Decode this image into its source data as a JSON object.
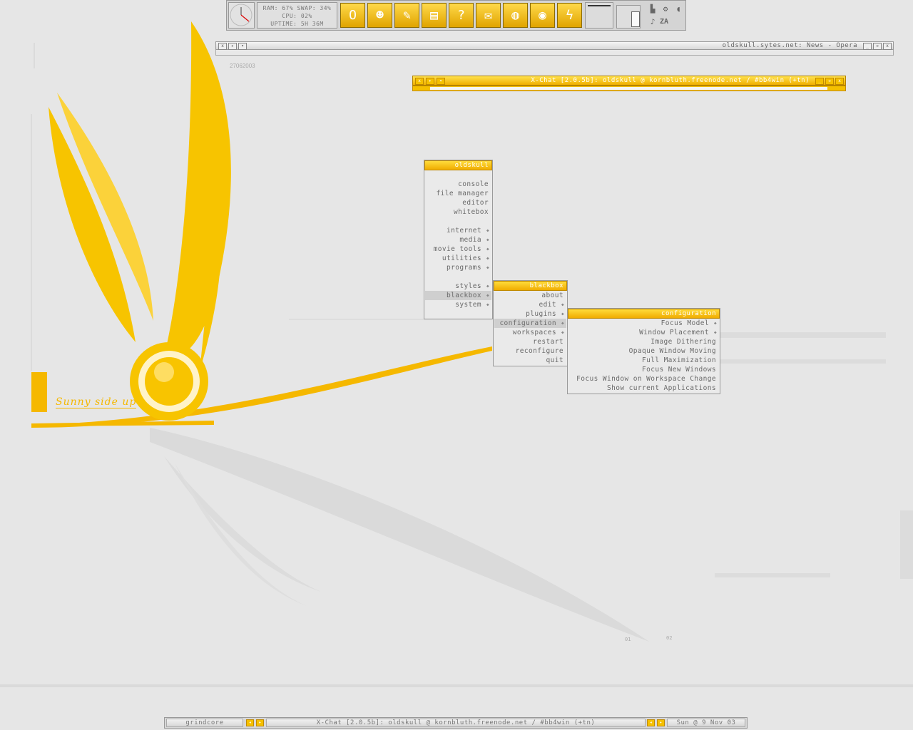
{
  "wallpaper": {
    "caption": "Sunny side up",
    "date_stamp": "27062003",
    "marker_1": "01",
    "marker_2": "02",
    "accent": "#f5b800"
  },
  "dock": {
    "stats": {
      "line1": "RAM: 67%  SWAP: 34%",
      "line2": "CPU: 02%",
      "line3": "UPTIME: 5H 36M"
    },
    "launchers": [
      {
        "icon": "opera-icon",
        "glyph": "O"
      },
      {
        "icon": "xchat-icon",
        "glyph": "☻"
      },
      {
        "icon": "chat-bubble-icon",
        "glyph": "✎"
      },
      {
        "icon": "drive-icon",
        "glyph": "▤"
      },
      {
        "icon": "help-icon",
        "glyph": "?"
      },
      {
        "icon": "mail-icon",
        "glyph": "✉"
      },
      {
        "icon": "jar-icon",
        "glyph": "◍"
      },
      {
        "icon": "globe-icon",
        "glyph": "◉"
      },
      {
        "icon": "lightning-icon",
        "glyph": "ϟ"
      }
    ],
    "tray_kb": "ZA"
  },
  "windows": {
    "opera_title": "oldskull.sytes.net: News - Opera",
    "xchat_title": "X-Chat [2.0.5b]: oldskull @ kornbluth.freenode.net / #bb4win (+tn)"
  },
  "menus": {
    "root": {
      "title": "oldskull",
      "items": [
        "console",
        "file manager",
        "editor",
        "whitebox"
      ],
      "submenus": [
        "internet",
        "media",
        "movie tools",
        "utilities",
        "programs"
      ],
      "bottom": [
        "styles",
        "blackbox",
        "system"
      ]
    },
    "blackbox": {
      "title": "blackbox",
      "items": [
        "about",
        "edit",
        "plugins",
        "configuration",
        "workspaces",
        "restart",
        "reconfigure",
        "quit"
      ]
    },
    "configuration": {
      "title": "configuration",
      "items": [
        "Focus Model",
        "Window Placement",
        "Image Dithering",
        "Opaque Window Moving",
        "Full Maximization",
        "Focus New Windows",
        "Focus Window on Workspace Change",
        "Show current Applications"
      ]
    }
  },
  "toolbar": {
    "workspace": "grindcore",
    "window_title": "X-Chat [2.0.5b]: oldskull @ kornbluth.freenode.net / #bb4win (+tn)",
    "clock": "Sun @ 9 Nov 03"
  }
}
